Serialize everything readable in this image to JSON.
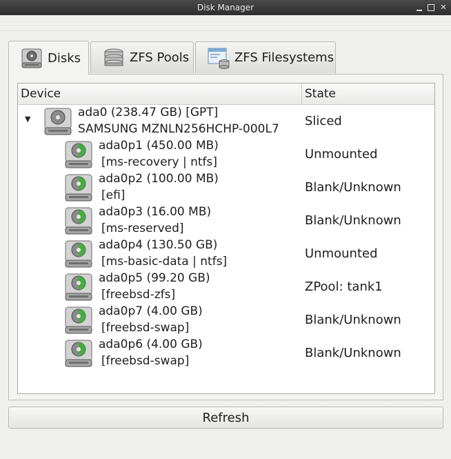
{
  "window": {
    "title": "Disk Manager",
    "controls": [
      "minimize",
      "maximize",
      "close"
    ]
  },
  "tabs": [
    {
      "label": "Disks",
      "icon": "hard-disk-icon",
      "active": true
    },
    {
      "label": "ZFS Pools",
      "icon": "zfs-pool-stack-icon",
      "active": false
    },
    {
      "label": "ZFS Filesystems",
      "icon": "zfs-filesystem-icon",
      "active": false
    }
  ],
  "tree": {
    "columns": [
      "Device",
      "State"
    ],
    "rows": [
      {
        "line1": "ada0 (238.47 GB) [GPT]",
        "line2": "SAMSUNG MZNLN256HCHP-000L7",
        "state": "Sliced",
        "level": 0,
        "expanded": true,
        "icon": "hard-disk-icon"
      },
      {
        "line1": "ada0p1 (450.00 MB)",
        "line2": "[ms-recovery | ntfs]",
        "state": "Unmounted",
        "level": 1,
        "icon": "partition-icon"
      },
      {
        "line1": "ada0p2 (100.00 MB)",
        "line2": "[efi]",
        "state": "Blank/Unknown",
        "level": 1,
        "icon": "partition-icon"
      },
      {
        "line1": "ada0p3 (16.00 MB)",
        "line2": "[ms-reserved]",
        "state": "Blank/Unknown",
        "level": 1,
        "icon": "partition-icon"
      },
      {
        "line1": "ada0p4 (130.50 GB)",
        "line2": "[ms-basic-data | ntfs]",
        "state": "Unmounted",
        "level": 1,
        "icon": "partition-icon"
      },
      {
        "line1": "ada0p5 (99.20 GB)",
        "line2": "[freebsd-zfs]",
        "state": "ZPool: tank1",
        "level": 1,
        "icon": "partition-icon"
      },
      {
        "line1": "ada0p7 (4.00 GB)",
        "line2": "[freebsd-swap]",
        "state": "Blank/Unknown",
        "level": 1,
        "icon": "partition-icon"
      },
      {
        "line1": "ada0p6 (4.00 GB)",
        "line2": "[freebsd-swap]",
        "state": "Blank/Unknown",
        "level": 1,
        "icon": "partition-icon"
      }
    ]
  },
  "buttons": {
    "refresh": "Refresh"
  },
  "colors": {
    "partition_accent": "#3fae3a",
    "titlebar": "#3a3a3a"
  }
}
